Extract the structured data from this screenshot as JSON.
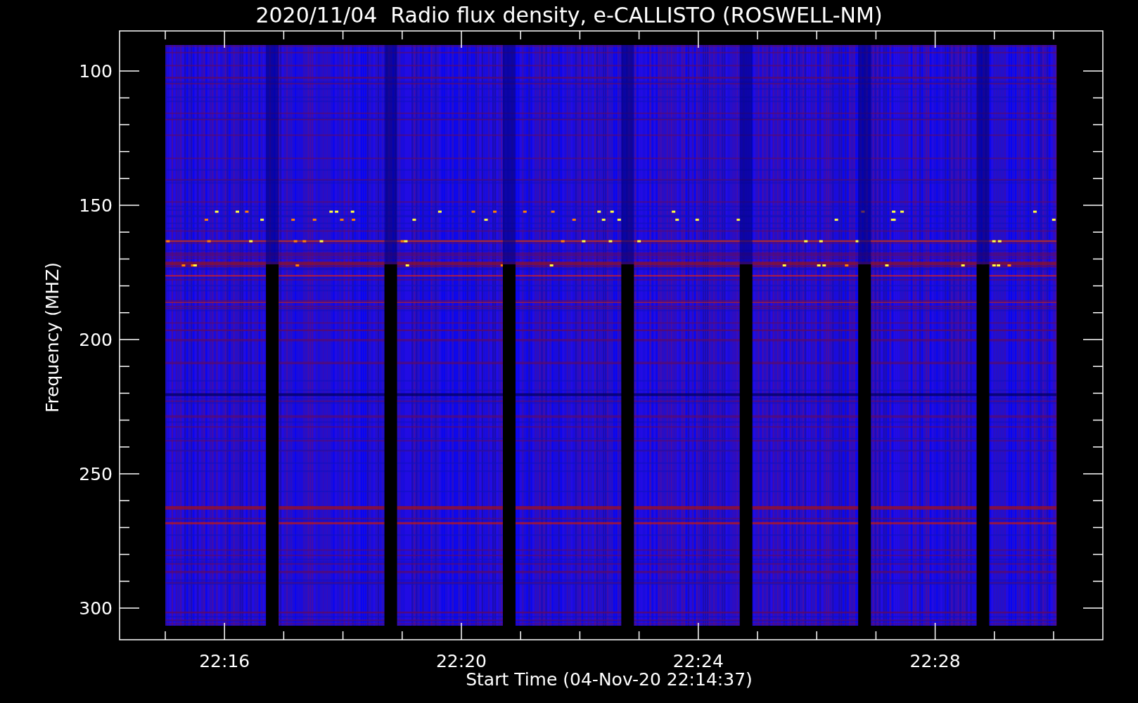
{
  "title": "2020/11/04  Radio flux density, e-CALLISTO (ROSWELL-NM)",
  "y_axis": {
    "label": "Frequency (MHZ)",
    "ticks": [
      "100",
      "150",
      "200",
      "250",
      "300"
    ]
  },
  "x_axis": {
    "label": "Start Time (04-Nov-20 22:14:37)",
    "ticks": [
      "22:16",
      "22:20",
      "22:24",
      "22:28"
    ]
  }
}
